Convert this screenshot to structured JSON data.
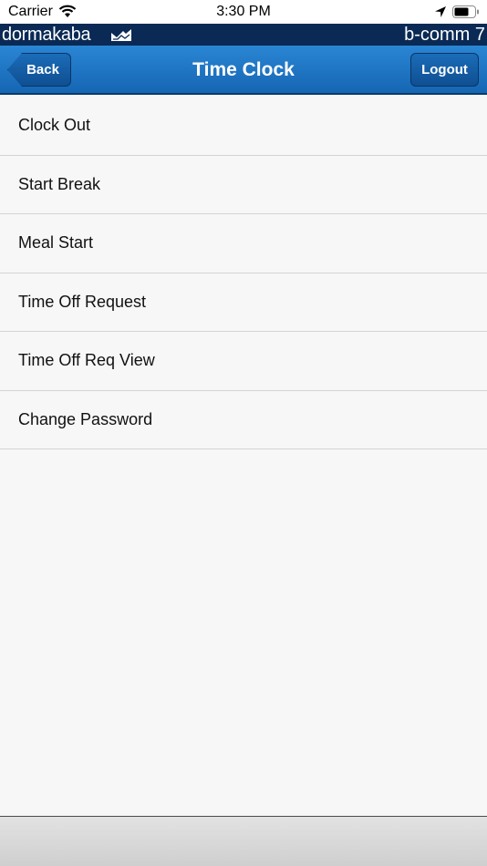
{
  "status_bar": {
    "carrier": "Carrier",
    "time": "3:30 PM",
    "icons": [
      "wifi-icon",
      "location-icon",
      "battery-icon"
    ]
  },
  "brand": {
    "logo_text": "dormakaba",
    "app_name": "b-comm 7",
    "colors": {
      "banner": "#0a2a55",
      "nav": "#1b75c6"
    }
  },
  "nav": {
    "title": "Time Clock",
    "back_label": "Back",
    "logout_label": "Logout"
  },
  "menu": {
    "items": [
      {
        "label": "Clock Out"
      },
      {
        "label": "Start Break"
      },
      {
        "label": "Meal Start"
      },
      {
        "label": "Time Off Request"
      },
      {
        "label": "Time Off Req View"
      },
      {
        "label": "Change Password"
      }
    ]
  }
}
